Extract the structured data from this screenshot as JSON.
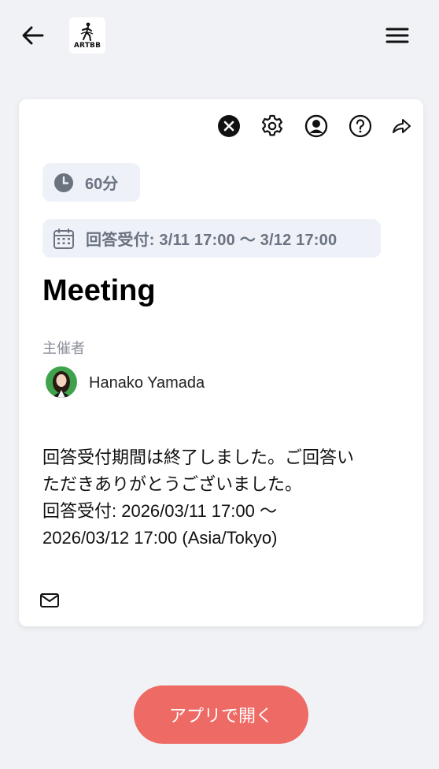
{
  "header": {
    "logo_text": "ARTBB"
  },
  "toolbar": {
    "icons": [
      "close-icon",
      "gear-icon",
      "user-circle-icon",
      "help-icon",
      "share-icon"
    ]
  },
  "event": {
    "duration": "60分",
    "response_period": "回答受付: 3/11 17:00 〜 3/12 17:00",
    "title": "Meeting",
    "organizer_label": "主催者",
    "organizer_name": "Hanako Yamada",
    "message_lines": [
      "回答受付期間は終了しました。ご回答い",
      "ただきありがとうございました。",
      "回答受付: 2026/03/11 17:00 〜",
      "2026/03/12 17:00 (Asia/Tokyo)"
    ]
  },
  "footer": {
    "open_app_label": "アプリで開く"
  },
  "colors": {
    "background": "#f1f2f6",
    "chip_bg": "#eef2f8",
    "accent": "#ee6a64"
  }
}
